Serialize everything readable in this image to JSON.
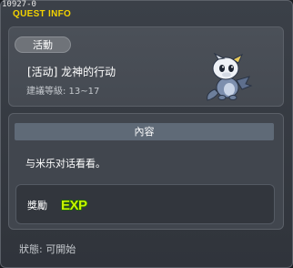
{
  "window": {
    "quest_id": "10927-0",
    "title": "QUEST INFO"
  },
  "quest": {
    "category": "活動",
    "name": "[活动] 龙神的行动",
    "level_range": "建議等級: 13~17",
    "npc_icon": "baby-dragon-icon"
  },
  "content": {
    "header": "內容",
    "description": "与米乐对话看看。"
  },
  "reward": {
    "label": "獎勵",
    "exp_text": "EXP",
    "exp_icon": "exp-icon"
  },
  "status": {
    "text": "狀態: 可開始"
  },
  "colors": {
    "title": "#f2d200",
    "exp_fill": "#c8f000",
    "exp_outline": "#1d6b00"
  }
}
